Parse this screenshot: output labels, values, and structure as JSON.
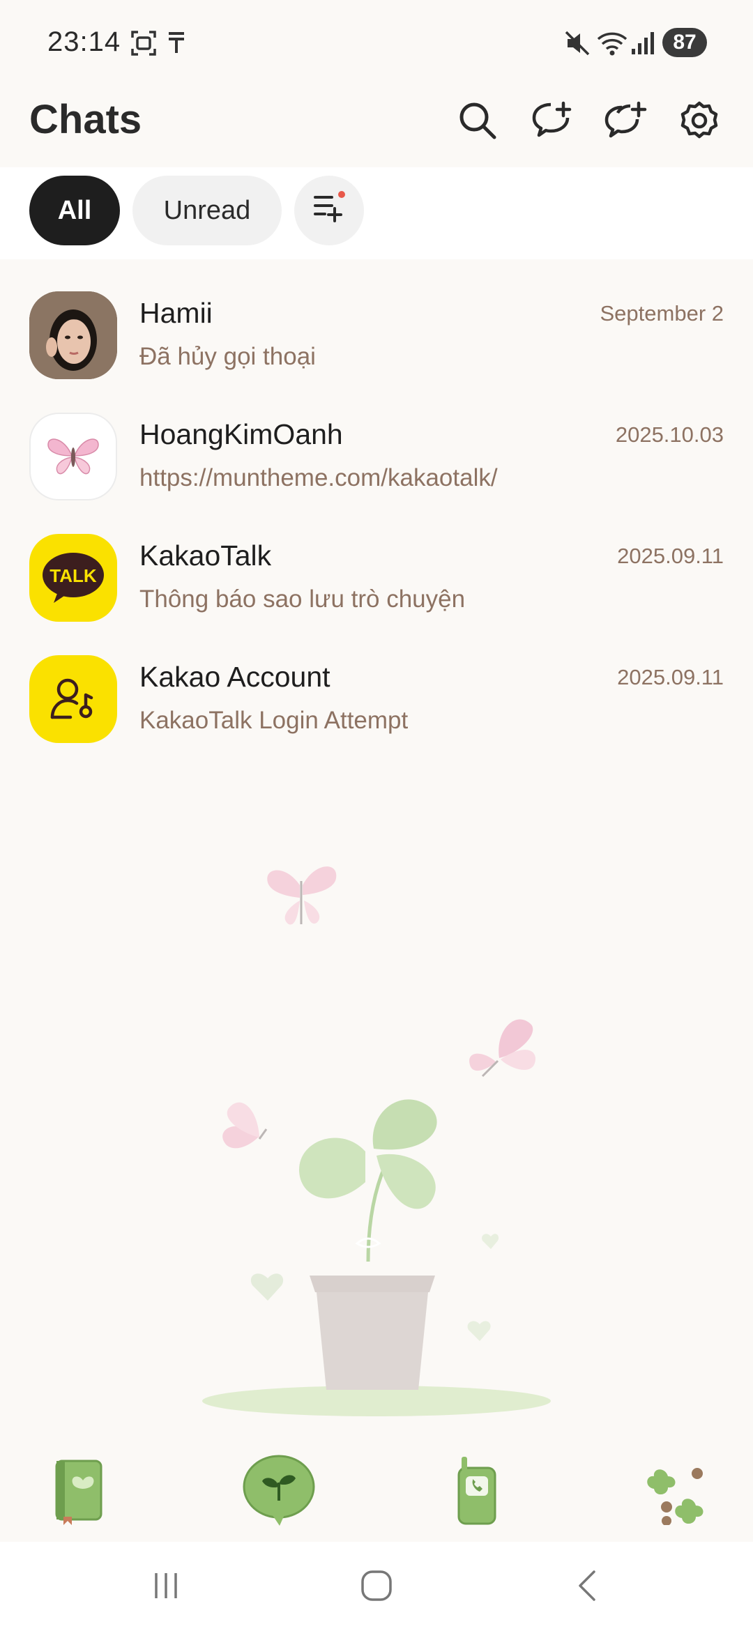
{
  "status_bar": {
    "time": "23:14",
    "battery": "87",
    "icons": [
      "screenshot-icon",
      "tag-icon",
      "mute-icon",
      "wifi-icon",
      "signal-icon",
      "battery-icon"
    ]
  },
  "header": {
    "title": "Chats",
    "actions": [
      "search-icon",
      "new-chat-icon",
      "new-group-chat-icon",
      "settings-icon"
    ]
  },
  "tabs": {
    "all": "All",
    "unread": "Unread",
    "add_filter_icon": "filter-add-icon"
  },
  "chats": [
    {
      "name": "Hamii",
      "preview": "Đã hủy gọi thoại",
      "date": "September 2",
      "avatar": "photo-avatar"
    },
    {
      "name": "HoangKimOanh",
      "preview": "https://muntheme.com/kakaotalk/",
      "date": "2025.10.03",
      "avatar": "butterfly-avatar"
    },
    {
      "name": "KakaoTalk",
      "preview": "Thông báo sao lưu trò chuyện",
      "date": "2025.09.11",
      "avatar": "talk-avatar",
      "avatar_text": "TALK"
    },
    {
      "name": "Kakao Account",
      "preview": "KakaoTalk Login Attempt",
      "date": "2025.09.11",
      "avatar": "account-avatar"
    }
  ],
  "bottom_nav": [
    "friends-book-icon",
    "chats-sprout-icon",
    "phone-call-icon",
    "more-clover-icon"
  ],
  "system_nav": [
    "recent-apps-icon",
    "home-icon",
    "back-icon"
  ],
  "colors": {
    "background": "#fbf9f6",
    "accent_dark": "#1e1e1e",
    "preview_text": "#8d7262",
    "kakao_yellow": "#fae100",
    "leaf_green": "#8fbe6a"
  }
}
